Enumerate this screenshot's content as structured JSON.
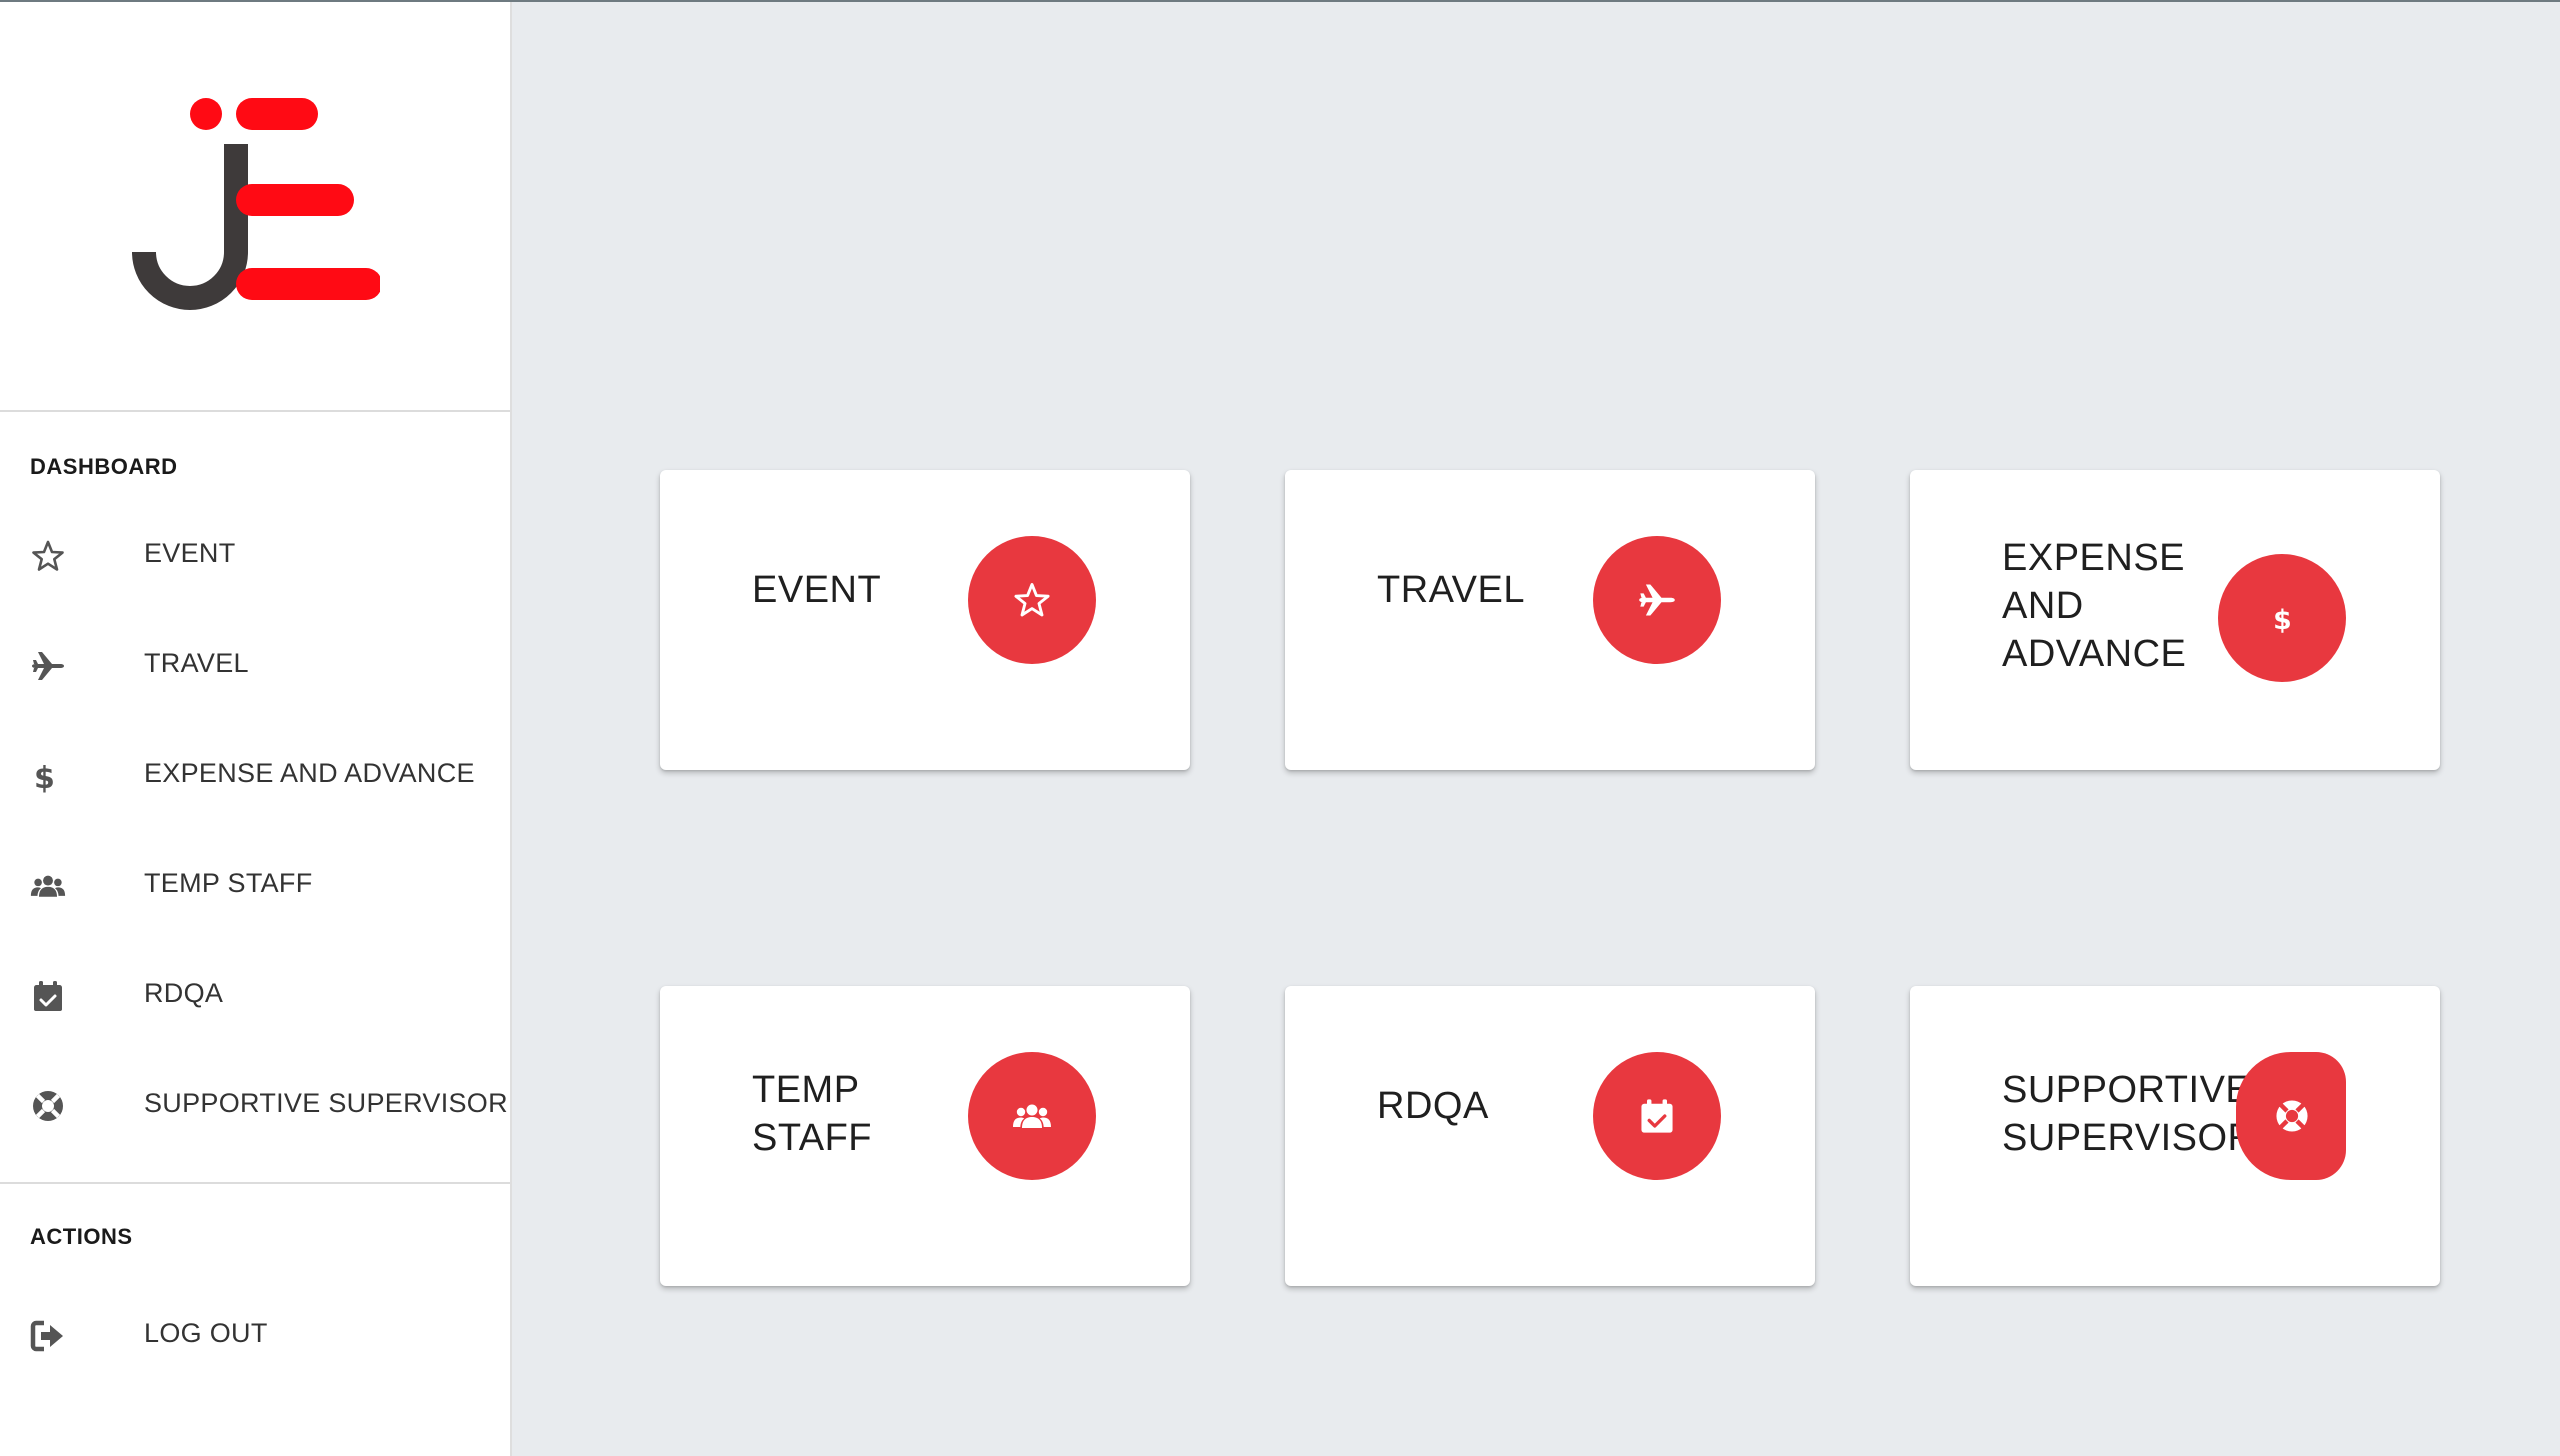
{
  "brand": {
    "accent_color": "#e8383f",
    "logo_dark": "#3e3a3a",
    "logo_red": "#ff0a14"
  },
  "sidebar": {
    "dashboard_title": "DASHBOARD",
    "items": [
      {
        "label": "EVENT",
        "icon": "star-icon"
      },
      {
        "label": "TRAVEL",
        "icon": "plane-icon"
      },
      {
        "label": "EXPENSE AND ADVANCE",
        "icon": "dollar-icon"
      },
      {
        "label": "TEMP STAFF",
        "icon": "users-icon"
      },
      {
        "label": "RDQA",
        "icon": "calendar-check-icon"
      },
      {
        "label": "SUPPORTIVE SUPERVISOR",
        "icon": "lifebuoy-icon"
      }
    ],
    "actions_title": "ACTIONS",
    "logout_label": "LOG OUT"
  },
  "cards": [
    {
      "title": "EVENT",
      "icon": "star-icon"
    },
    {
      "title": "TRAVEL",
      "icon": "plane-icon"
    },
    {
      "title": "EXPENSE\nAND\nADVANCE",
      "icon": "dollar-icon"
    },
    {
      "title": "TEMP\nSTAFF",
      "icon": "users-icon"
    },
    {
      "title": "RDQA",
      "icon": "calendar-check-icon"
    },
    {
      "title": "SUPPORTIVE\nSUPERVISOR",
      "icon": "lifebuoy-icon"
    }
  ]
}
